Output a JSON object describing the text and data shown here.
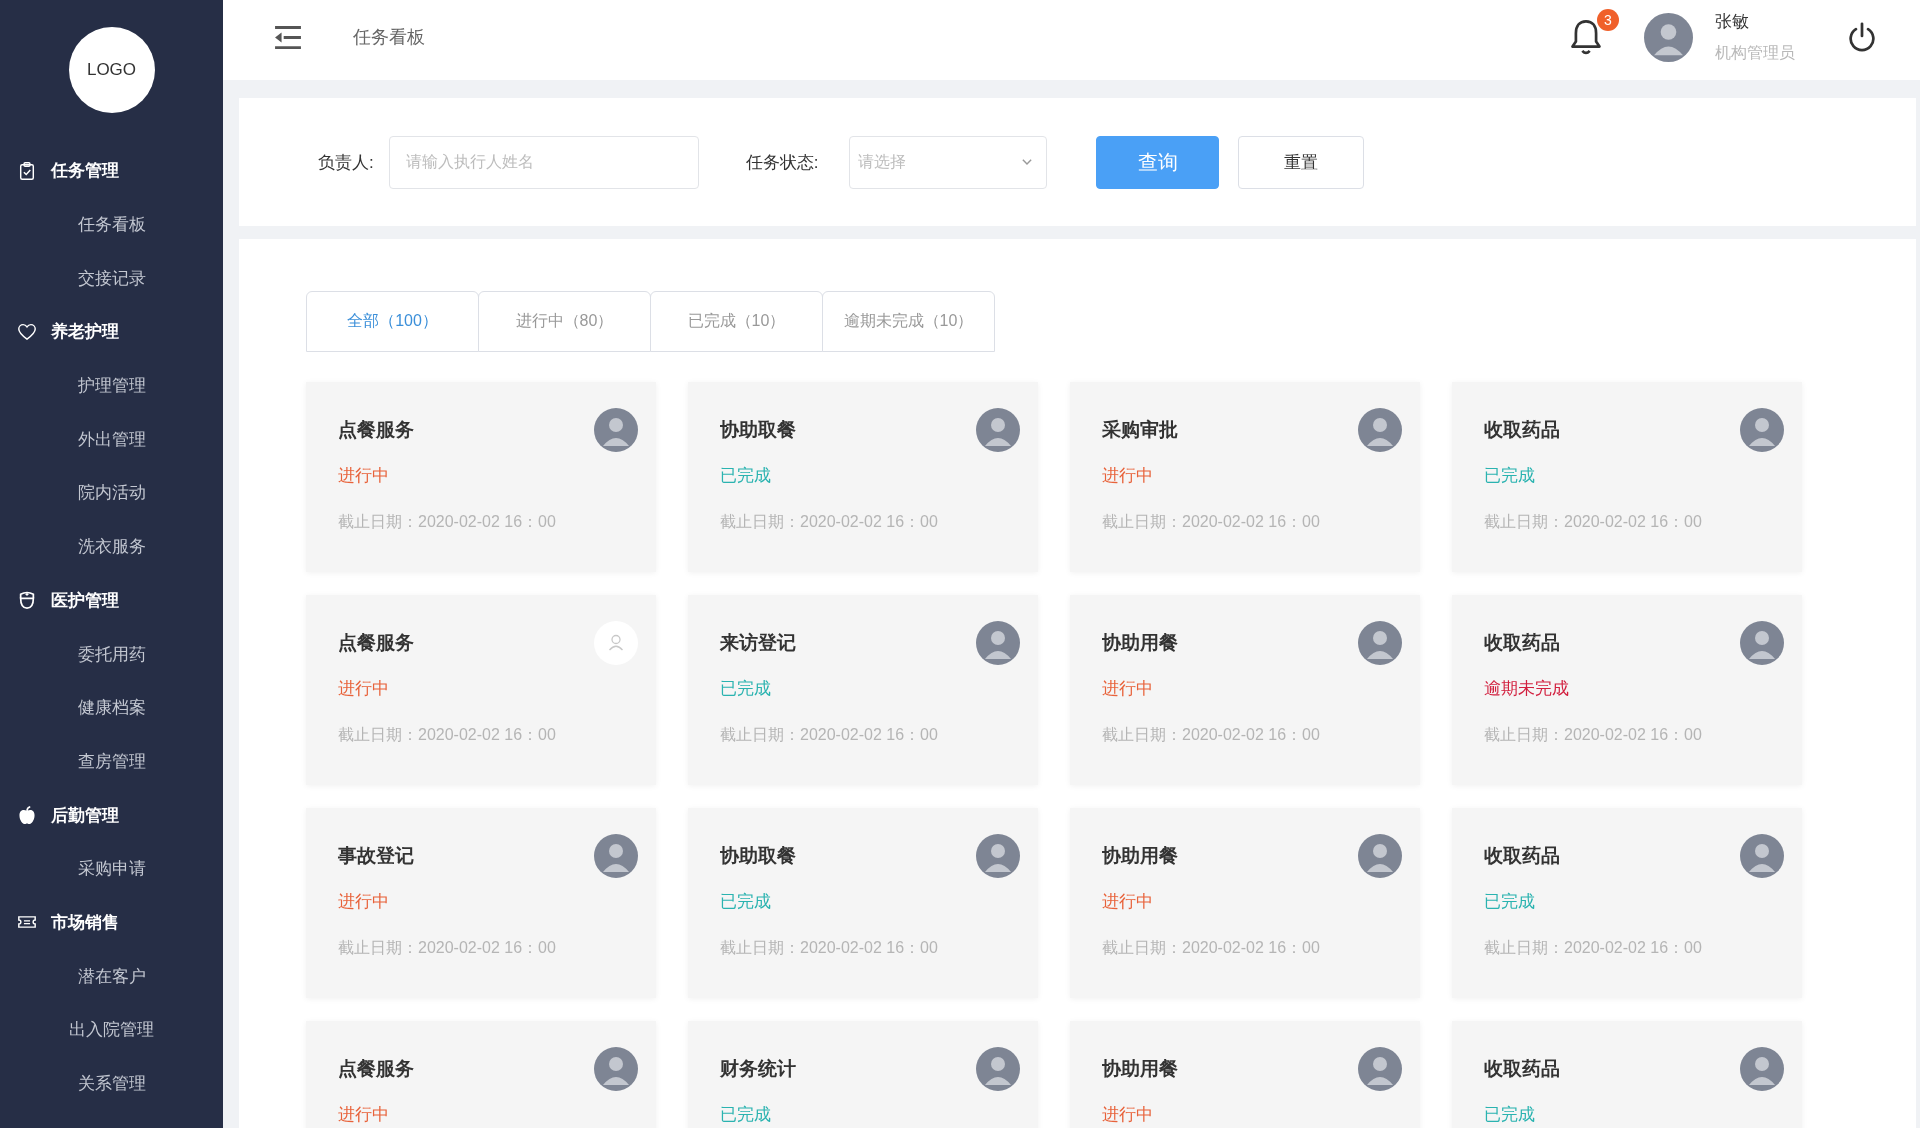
{
  "sidebar": {
    "logo": "LOGO",
    "groups": [
      {
        "label": "任务管理",
        "children": [
          {
            "label": "任务看板"
          },
          {
            "label": "交接记录"
          }
        ]
      },
      {
        "label": "养老护理",
        "children": [
          {
            "label": "护理管理"
          },
          {
            "label": "外出管理"
          },
          {
            "label": "院内活动"
          },
          {
            "label": "洗衣服务"
          }
        ]
      },
      {
        "label": "医护管理",
        "children": [
          {
            "label": "委托用药"
          },
          {
            "label": "健康档案"
          },
          {
            "label": "查房管理"
          }
        ]
      },
      {
        "label": "后勤管理",
        "children": [
          {
            "label": "采购申请"
          }
        ]
      },
      {
        "label": "市场销售",
        "children": [
          {
            "label": "潜在客户"
          },
          {
            "label": "出入院管理"
          },
          {
            "label": "关系管理"
          }
        ]
      }
    ]
  },
  "header": {
    "title": "任务看板",
    "badge": "3",
    "user": {
      "name": "张敏",
      "role": "机构管理员",
      "photo": true
    }
  },
  "filters": {
    "fields": [
      {
        "kind": "text",
        "label": "负责人:",
        "placeholder": "请输入执行人姓名"
      },
      {
        "kind": "select",
        "label": "任务状态:",
        "placeholder": "请选择"
      }
    ],
    "buttons": [
      {
        "kind": "primary",
        "label": "查询"
      },
      {
        "kind": "default",
        "label": "重置"
      }
    ]
  },
  "tabs": [
    {
      "label": "全部（100）",
      "selected": true
    },
    {
      "label": "进行中（80）",
      "selected": false
    },
    {
      "label": "已完成（10）",
      "selected": false
    },
    {
      "label": "逾期未完成（10）",
      "selected": false
    }
  ],
  "tasks": [
    {
      "title": "点餐服务",
      "status": {
        "text": "进行中",
        "kind": "progress"
      },
      "deadline": "截止日期：2020-02-02 16：00",
      "photo": true
    },
    {
      "title": "协助取餐",
      "status": {
        "text": "已完成",
        "kind": "done"
      },
      "deadline": "截止日期：2020-02-02 16：00",
      "photo": true
    },
    {
      "title": "采购审批",
      "status": {
        "text": "进行中",
        "kind": "progress"
      },
      "deadline": "截止日期：2020-02-02 16：00",
      "photo": true
    },
    {
      "title": "收取药品",
      "status": {
        "text": "已完成",
        "kind": "done"
      },
      "deadline": "截止日期：2020-02-02 16：00",
      "photo": true
    },
    {
      "title": "点餐服务",
      "status": {
        "text": "进行中",
        "kind": "progress"
      },
      "deadline": "截止日期：2020-02-02 16：00",
      "photo": false
    },
    {
      "title": "来访登记",
      "status": {
        "text": "已完成",
        "kind": "done"
      },
      "deadline": "截止日期：2020-02-02 16：00",
      "photo": true
    },
    {
      "title": "协助用餐",
      "status": {
        "text": "进行中",
        "kind": "progress"
      },
      "deadline": "截止日期：2020-02-02 16：00",
      "photo": true
    },
    {
      "title": "收取药品",
      "status": {
        "text": "逾期未完成",
        "kind": "overdue"
      },
      "deadline": "截止日期：2020-02-02 16：00",
      "photo": true
    },
    {
      "title": "事故登记",
      "status": {
        "text": "进行中",
        "kind": "progress"
      },
      "deadline": "截止日期：2020-02-02 16：00",
      "photo": true
    },
    {
      "title": "协助取餐",
      "status": {
        "text": "已完成",
        "kind": "done"
      },
      "deadline": "截止日期：2020-02-02 16：00",
      "photo": true
    },
    {
      "title": "协助用餐",
      "status": {
        "text": "进行中",
        "kind": "progress"
      },
      "deadline": "截止日期：2020-02-02 16：00",
      "photo": true
    },
    {
      "title": "收取药品",
      "status": {
        "text": "已完成",
        "kind": "done"
      },
      "deadline": "截止日期：2020-02-02 16：00",
      "photo": true
    },
    {
      "title": "点餐服务",
      "status": {
        "text": "进行中",
        "kind": "progress"
      },
      "photo": true
    },
    {
      "title": "财务统计",
      "status": {
        "text": "已完成",
        "kind": "done"
      },
      "photo": true
    },
    {
      "title": "协助用餐",
      "status": {
        "text": "进行中",
        "kind": "progress"
      },
      "photo": true
    },
    {
      "title": "收取药品",
      "status": {
        "text": "已完成",
        "kind": "done"
      },
      "photo": true
    }
  ]
}
